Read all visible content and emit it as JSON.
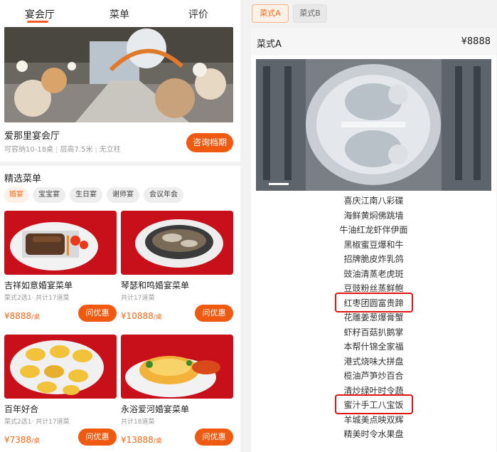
{
  "left_tabs": [
    "宴会厅",
    "菜单",
    "评价"
  ],
  "hall": {
    "name": "爱那里宴会厅",
    "capacity": "可容纳10-18桌",
    "height": "层高7.5米",
    "pillar": "无立柱",
    "consult_label": "咨询档期"
  },
  "section_title": "精选菜单",
  "chips": [
    "婚宴",
    "宝宝宴",
    "生日宴",
    "谢师宴",
    "会议年会"
  ],
  "cards": [
    {
      "title": "吉祥如意婚宴菜单",
      "sub": "菜式2选1· 共计17道菜",
      "price": "¥8888",
      "unit": "/桌",
      "btn": "问优惠"
    },
    {
      "title": "琴瑟和鸣婚宴菜单",
      "sub": "共计17道菜",
      "price": "¥10888",
      "unit": "/桌",
      "btn": "问优惠"
    },
    {
      "title": "百年好合",
      "sub": "菜式2选1· 共计17道菜",
      "price": "¥7388",
      "unit": "/桌",
      "btn": "问优惠"
    },
    {
      "title": "永浴爱河婚宴菜单",
      "sub": "共计18道菜",
      "price": "¥13888",
      "unit": "/桌",
      "btn": "问优惠"
    }
  ],
  "right_tabs": [
    "菜式A",
    "菜式B"
  ],
  "menu": {
    "name": "菜式A",
    "price": "¥8888",
    "dishes": [
      "喜庆江南八彩碟",
      "海鲜黄焖佛跳墙",
      "牛油红龙虾伴伊面",
      "黑椒蜜豆爆和牛",
      "招牌脆皮炸乳鸽",
      "豉油清蒸老虎斑",
      "豆豉粉丝蒸鲜鲍",
      "红枣团圆富贵蹄",
      "花雕姜葱爆膏蟹",
      "虾籽百菇扒鹅掌",
      "本帮什锦全家福",
      "港式烧味大拼盘",
      "榄油芦笋炒百合",
      "清炒绿叶时令蔬",
      "蜜汁手工八宝饭",
      "羊城美点映双辉",
      "精美时令水果盘"
    ]
  },
  "colors": {
    "accent": "#f05a10",
    "highlight_box": "#e01515",
    "card_bg": "#c8101b"
  }
}
